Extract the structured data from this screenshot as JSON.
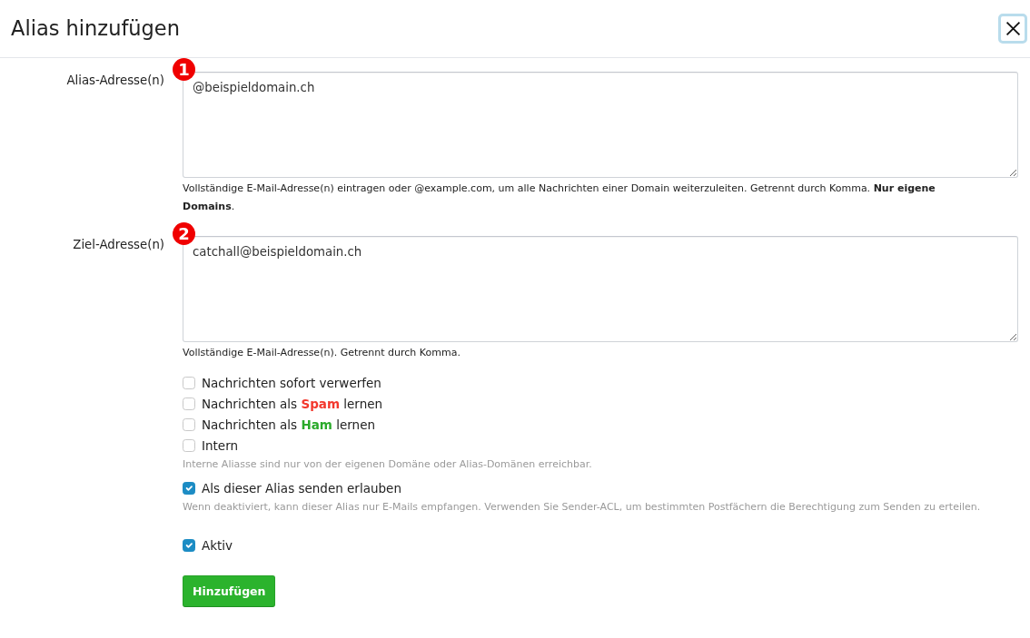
{
  "dialog": {
    "title": "Alias hinzufügen",
    "close_button": {
      "focused": true
    }
  },
  "fields": [
    {
      "label": "Alias-Adresse(n)",
      "value": "@beispieldomain.ch",
      "marker": "1",
      "help": "Vollständige E-Mail-Adresse(n) eintragen oder @example.com, um alle Nachrichten einer Domain weiterzuleiten. Getrennt durch Komma. **Nur eigene Domains**."
    },
    {
      "label": "Ziel-Adresse(n)",
      "value": "catchall@beispieldomain.ch",
      "marker": "2",
      "help": "Vollständige E-Mail-Adresse(n). Getrennt durch Komma."
    }
  ],
  "options": [
    {
      "label": "Nachrichten sofort verwerfen",
      "checked": false
    },
    {
      "label": "Nachrichten als **Spam** lernen",
      "color": "#f3382d",
      "checked": false
    },
    {
      "label": "Nachrichten als **Ham** lernen",
      "color": "#2aaa2a",
      "checked": false
    },
    {
      "label": "Intern",
      "checked": false,
      "help": "Interne Aliasse sind nur von der eigenen Domäne oder Alias-Domänen erreichbar."
    },
    {
      "label": "Als dieser Alias senden erlauben",
      "checked": true,
      "help": "Wenn deaktiviert, kann dieser Alias nur E-Mails empfangen. Verwenden Sie Sender-ACL, um bestimmten Postfächern die Berechtigung zum Senden zu erteilen."
    }
  ],
  "active": {
    "label": "Aktiv",
    "checked": true
  },
  "submit_button": "Hinzufügen"
}
